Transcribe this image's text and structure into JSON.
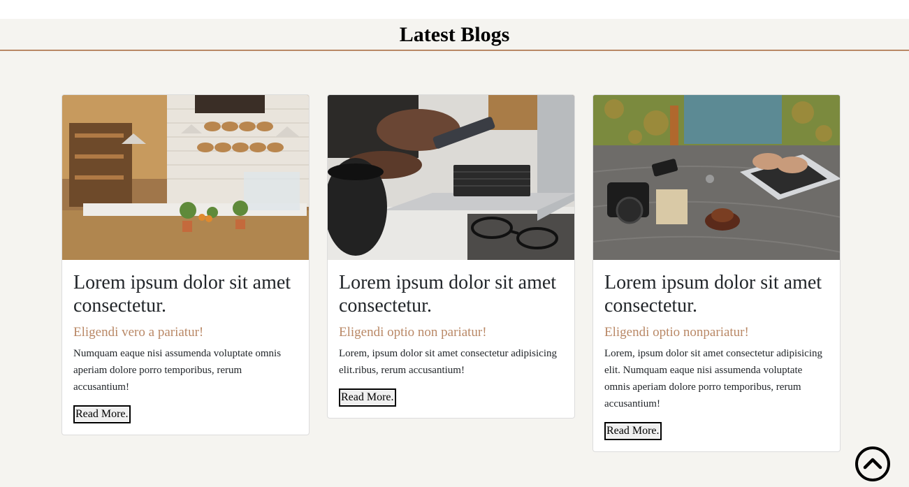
{
  "section": {
    "heading": "Latest Blogs"
  },
  "colors": {
    "accent": "#b98866",
    "background": "#f5f4f0"
  },
  "cards": [
    {
      "image": "bakery-cafe-photo",
      "title": "Lorem ipsum dolor sit amet consectetur.",
      "subtitle": "Eligendi vero a pariatur!",
      "text": "Numquam eaque nisi assumenda voluptate omnis aperiam dolore porro temporibus, rerum accusantium!",
      "button": "Read More."
    },
    {
      "image": "laptop-phone-photo",
      "title": "Lorem ipsum dolor sit amet consectetur.",
      "subtitle": "Eligendi optio non pariatur!",
      "text": "Lorem, ipsum dolor sit amet consectetur adipisicing elit.ribus, rerum accusantium!",
      "button": "Read More."
    },
    {
      "image": "desk-camera-laptop-photo",
      "title": "Lorem ipsum dolor sit amet consectetur.",
      "subtitle": "Eligendi optio nonpariatur!",
      "text": "Lorem, ipsum dolor sit amet consectetur adipisicing elit. Numquam eaque nisi assumenda voluptate omnis aperiam dolore porro temporibus, rerum accusantium!",
      "button": "Read More."
    }
  ],
  "scroll_top": {
    "icon": "chevron-up-circle-icon"
  }
}
